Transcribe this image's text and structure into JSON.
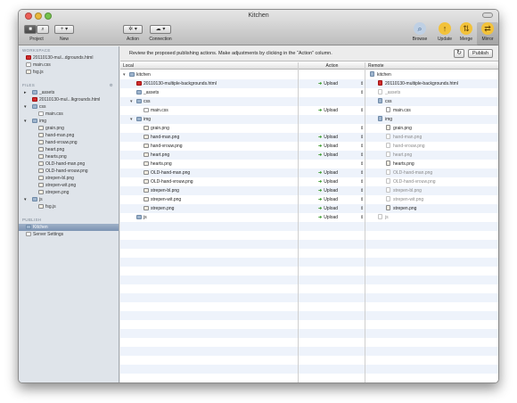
{
  "window": {
    "title": "Kitchen"
  },
  "toolbar": {
    "project_label": "Project",
    "new_label": "New",
    "action_label": "Action",
    "connection_label": "Connection",
    "browse_label": "Browse",
    "update_label": "Update",
    "merge_label": "Merge",
    "mirror_label": "Mirror"
  },
  "sidebar": {
    "workspace_header": "WORKSPACE",
    "workspace_items": [
      {
        "label": "20110130-mul...dgrounds.html",
        "icon": "html-file-icon"
      },
      {
        "label": "main.css",
        "icon": "css-file-icon"
      },
      {
        "label": "fsg.js",
        "icon": "js-file-icon"
      }
    ],
    "files_header": "FILES",
    "file_items": [
      {
        "label": "_assets",
        "icon": "folder-icon",
        "indent": 1,
        "disclosure": "▸"
      },
      {
        "label": "20110130-mul...lkgrounds.html",
        "icon": "html-file-icon",
        "indent": 1,
        "disclosure": ""
      },
      {
        "label": "css",
        "icon": "folder-icon",
        "indent": 1,
        "disclosure": "▾"
      },
      {
        "label": "main.css",
        "icon": "css-file-icon",
        "indent": 2,
        "disclosure": ""
      },
      {
        "label": "img",
        "icon": "folder-icon",
        "indent": 1,
        "disclosure": "▾"
      },
      {
        "label": "grain.png",
        "icon": "image-file-icon",
        "indent": 2,
        "disclosure": ""
      },
      {
        "label": "hand-man.png",
        "icon": "image-file-icon",
        "indent": 2,
        "disclosure": ""
      },
      {
        "label": "hand-vrouw.png",
        "icon": "image-file-icon",
        "indent": 2,
        "disclosure": ""
      },
      {
        "label": "heart.png",
        "icon": "image-file-icon",
        "indent": 2,
        "disclosure": ""
      },
      {
        "label": "hearts.png",
        "icon": "image-file-icon",
        "indent": 2,
        "disclosure": ""
      },
      {
        "label": "OLD-hand-man.png",
        "icon": "image-file-icon",
        "indent": 2,
        "disclosure": ""
      },
      {
        "label": "OLD-hand-vrouw.png",
        "icon": "image-file-icon",
        "indent": 2,
        "disclosure": ""
      },
      {
        "label": "strepen-bl.png",
        "icon": "image-file-icon",
        "indent": 2,
        "disclosure": ""
      },
      {
        "label": "strepen-wit.png",
        "icon": "image-file-icon",
        "indent": 2,
        "disclosure": ""
      },
      {
        "label": "strepen.png",
        "icon": "image-file-icon",
        "indent": 2,
        "disclosure": ""
      },
      {
        "label": "js",
        "icon": "folder-icon",
        "indent": 1,
        "disclosure": "▾"
      },
      {
        "label": "fsg.js",
        "icon": "js-file-icon",
        "indent": 2,
        "disclosure": ""
      }
    ],
    "publish_header": "PUBLISH",
    "publish_items": [
      {
        "label": "Kitchen",
        "icon": "server-icon",
        "selected": true
      },
      {
        "label": "Server Settings",
        "icon": "settings-icon",
        "selected": false
      }
    ]
  },
  "publish_panel": {
    "info_text": "Review the proposed publishing actions. Make adjustments by clicking in the “Action” column.",
    "publish_button": "Publish",
    "columns": {
      "local": "Local",
      "action": "Action",
      "remote": "Remote"
    }
  },
  "publish_rows": [
    {
      "local": "kitchen",
      "local_icon": "folder-icon",
      "local_indent": 1,
      "disclosure": "▾",
      "action": "",
      "stepper": false,
      "remote": "kitchen",
      "remote_icon": "folder-icon",
      "remote_dim": false
    },
    {
      "local": "20110130-multiple-backgrounds.html",
      "local_icon": "html-file-icon",
      "local_indent": 2,
      "disclosure": "",
      "action": "Upload",
      "stepper": true,
      "remote": "20110130-multiple-backgrounds.html",
      "remote_icon": "html-file-icon",
      "remote_dim": false
    },
    {
      "local": "_assets",
      "local_icon": "folder-icon",
      "local_indent": 2,
      "disclosure": "",
      "action": "",
      "stepper": true,
      "remote": "_assets",
      "remote_icon": "folder-icon",
      "remote_dim": true
    },
    {
      "local": "css",
      "local_icon": "folder-icon",
      "local_indent": 2,
      "disclosure": "▾",
      "action": "",
      "stepper": false,
      "remote": "css",
      "remote_icon": "folder-icon",
      "remote_dim": false
    },
    {
      "local": "main.css",
      "local_icon": "css-file-icon",
      "local_indent": 3,
      "disclosure": "",
      "action": "Upload",
      "stepper": true,
      "remote": "main.css",
      "remote_icon": "css-file-icon",
      "remote_dim": false
    },
    {
      "local": "img",
      "local_icon": "folder-icon",
      "local_indent": 2,
      "disclosure": "▾",
      "action": "",
      "stepper": false,
      "remote": "img",
      "remote_icon": "folder-icon",
      "remote_dim": false
    },
    {
      "local": "grain.png",
      "local_icon": "image-file-icon",
      "local_indent": 3,
      "disclosure": "",
      "action": "",
      "stepper": true,
      "remote": "grain.png",
      "remote_icon": "image-file-icon",
      "remote_dim": false
    },
    {
      "local": "hand-man.png",
      "local_icon": "image-file-icon",
      "local_indent": 3,
      "disclosure": "",
      "action": "Upload",
      "stepper": true,
      "remote": "hand-man.png",
      "remote_icon": "image-file-icon",
      "remote_dim": true
    },
    {
      "local": "hand-vrouw.png",
      "local_icon": "image-file-icon",
      "local_indent": 3,
      "disclosure": "",
      "action": "Upload",
      "stepper": true,
      "remote": "hand-vrouw.png",
      "remote_icon": "image-file-icon",
      "remote_dim": true
    },
    {
      "local": "heart.png",
      "local_icon": "image-file-icon",
      "local_indent": 3,
      "disclosure": "",
      "action": "Upload",
      "stepper": true,
      "remote": "heart.png",
      "remote_icon": "image-file-icon",
      "remote_dim": true
    },
    {
      "local": "hearts.png",
      "local_icon": "image-file-icon",
      "local_indent": 3,
      "disclosure": "",
      "action": "",
      "stepper": true,
      "remote": "hearts.png",
      "remote_icon": "image-file-icon",
      "remote_dim": false
    },
    {
      "local": "OLD-hand-man.png",
      "local_icon": "image-file-icon",
      "local_indent": 3,
      "disclosure": "",
      "action": "Upload",
      "stepper": true,
      "remote": "OLD-hand-man.png",
      "remote_icon": "image-file-icon",
      "remote_dim": true
    },
    {
      "local": "OLD-hand-vrouw.png",
      "local_icon": "image-file-icon",
      "local_indent": 3,
      "disclosure": "",
      "action": "Upload",
      "stepper": true,
      "remote": "OLD-hand-vrouw.png",
      "remote_icon": "image-file-icon",
      "remote_dim": true
    },
    {
      "local": "strepen-bl.png",
      "local_icon": "image-file-icon",
      "local_indent": 3,
      "disclosure": "",
      "action": "Upload",
      "stepper": true,
      "remote": "strepen-bl.png",
      "remote_icon": "image-file-icon",
      "remote_dim": true
    },
    {
      "local": "strepen-wit.png",
      "local_icon": "image-file-icon",
      "local_indent": 3,
      "disclosure": "",
      "action": "Upload",
      "stepper": true,
      "remote": "strepen-wit.png",
      "remote_icon": "image-file-icon",
      "remote_dim": true
    },
    {
      "local": "strepen.png",
      "local_icon": "image-file-icon",
      "local_indent": 3,
      "disclosure": "",
      "action": "Upload",
      "stepper": true,
      "remote": "strepen.png",
      "remote_icon": "image-file-icon",
      "remote_dim": false
    },
    {
      "local": "js",
      "local_icon": "folder-icon",
      "local_indent": 2,
      "disclosure": "",
      "action": "Upload",
      "stepper": true,
      "remote": "js",
      "remote_icon": "folder-icon",
      "remote_dim": true
    }
  ],
  "colors": {
    "upload_arrow": "#3b9a2e",
    "sidebar_bg": "#dfe4ea",
    "row_stripe": "#eef3fb",
    "selection": "#7c93b2"
  }
}
